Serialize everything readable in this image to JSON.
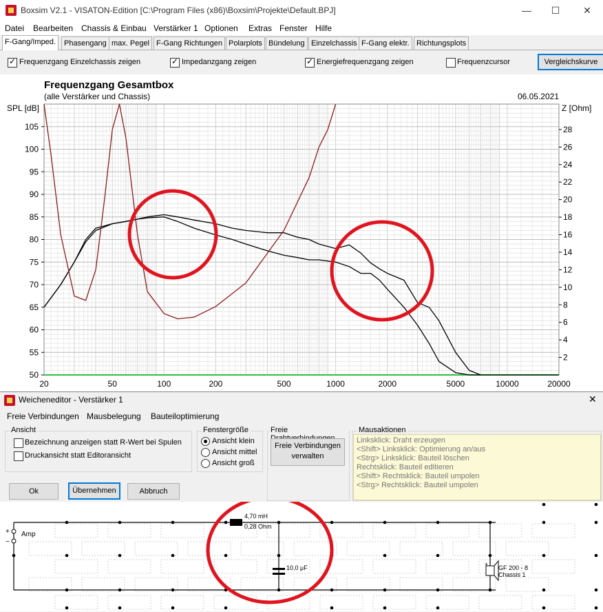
{
  "window": {
    "title": "Boxsim V2.1 - VISATON-Edition [C:\\Program Files (x86)\\Boxsim\\Projekte\\Default.BPJ]",
    "min_glyph": "—",
    "max_glyph": "☐",
    "close_glyph": "✕"
  },
  "menu": [
    "Datei",
    "Bearbeiten",
    "Chassis & Einbau",
    "Verstärker 1",
    "Optionen",
    "Extras",
    "Fenster",
    "Hilfe"
  ],
  "tabs": [
    "F-Gang/Imped.",
    "Phasengang",
    "max. Pegel",
    "F-Gang Richtungen",
    "Polarplots",
    "Bündelung",
    "Einzelchassis",
    "F-Gang elektr.",
    "Richtungsplots"
  ],
  "toolbar": {
    "chk1": "Frequenzgang Einzelchassis zeigen",
    "chk2": "Impedanzgang zeigen",
    "chk3": "Energiefrequenzgang zeigen",
    "chk4": "Frequenzcursor",
    "button": "Vergleichskurve"
  },
  "chart_data": {
    "type": "line",
    "title": "Frequenzgang Gesamtbox",
    "subtitle": "(alle Verstärker und Chassis)",
    "date": "06.05.2021",
    "ylabel": "SPL [dB]",
    "y2label": "Z [Ohm]",
    "x_scale": "log",
    "xlim": [
      20,
      20000
    ],
    "ylim": [
      50,
      110
    ],
    "y2lim": [
      0,
      30.9
    ],
    "x_ticks": [
      "20",
      "50",
      "100",
      "200",
      "500",
      "1000",
      "2000",
      "5000",
      "10000",
      "20000"
    ],
    "y_ticks": [
      "50",
      "55",
      "60",
      "65",
      "70",
      "75",
      "80",
      "85",
      "90",
      "95",
      "100",
      "105"
    ],
    "y2_ticks": [
      "2",
      "4",
      "6",
      "8",
      "10",
      "12",
      "14",
      "16",
      "18",
      "20",
      "22",
      "24",
      "26",
      "28"
    ],
    "grid": true,
    "series": [
      {
        "color": "#000000",
        "axis": "left",
        "x": [
          20,
          25,
          30,
          35,
          40,
          50,
          60,
          70,
          80,
          100,
          120,
          150,
          200,
          250,
          300,
          400,
          500,
          600,
          700,
          800,
          1000,
          1200,
          1400,
          1600,
          1800,
          2000,
          2500,
          3000,
          3500,
          4000,
          5000,
          6000,
          7000,
          10000,
          15000,
          20000
        ],
        "y": [
          65,
          70,
          75,
          80,
          82.5,
          83.5,
          84,
          84.5,
          85,
          85.5,
          85,
          84.3,
          83.5,
          82.5,
          82,
          81.5,
          81.5,
          80.5,
          80,
          79,
          78,
          78.8,
          77,
          74.8,
          73.5,
          72.5,
          71,
          66,
          65,
          62,
          55,
          51,
          50,
          50,
          50,
          50
        ]
      },
      {
        "color": "#000000",
        "axis": "left",
        "x": [
          20,
          25,
          30,
          35,
          40,
          50,
          60,
          70,
          80,
          100,
          120,
          150,
          200,
          250,
          300,
          400,
          500,
          600,
          700,
          800,
          1000,
          1200,
          1400,
          1600,
          1800,
          2000,
          2500,
          3000,
          3500,
          4000,
          5000,
          6000,
          7000
        ],
        "y": [
          65,
          70,
          75,
          79.5,
          82,
          83.5,
          84,
          84.5,
          84.8,
          85,
          84,
          82.5,
          81,
          80,
          79,
          77.5,
          76.5,
          76,
          75.5,
          75.5,
          75,
          74,
          72.5,
          72.5,
          71,
          69,
          65,
          61,
          57,
          53,
          50.5,
          50,
          50
        ]
      },
      {
        "color": "#8b1a1a",
        "axis": "right",
        "x": [
          20,
          22,
          25,
          30,
          35,
          40,
          45,
          50,
          55,
          60,
          70,
          80,
          100,
          120,
          150,
          200,
          300,
          500,
          700,
          800,
          900,
          1000
        ],
        "y": [
          30.9,
          25,
          16,
          9,
          8.5,
          12,
          20,
          28,
          30.9,
          27,
          16,
          9.5,
          7,
          6.4,
          6.6,
          7.8,
          10.5,
          16.5,
          22.5,
          26,
          28,
          30.9
        ]
      }
    ]
  },
  "dialog": {
    "title": "Weicheneditor - Verstärker 1",
    "close_glyph": "✕",
    "menu": [
      "Freie Verbindungen",
      "Mausbelegung",
      "Bauteiloptimierung"
    ],
    "ansicht_title": "Ansicht",
    "ansicht_opt1": "Bezeichnung anzeigen statt R-Wert bei Spulen",
    "ansicht_opt2": "Druckansicht statt Editoransicht",
    "fenster_title": "Fenstergröße",
    "radio1": "Ansicht klein",
    "radio2": "Ansicht mittel",
    "radio3": "Ansicht groß",
    "draht_title": "Freie Drahtverbindungen",
    "draht_button": "Freie Verbindungen verwalten",
    "maus_title": "Mausaktionen",
    "maus_lines": [
      "Linksklick: Draht erzeugen",
      "<Shift> Linksklick: Optimierung an/aus",
      "<Strg> Linksklick: Bauteil löschen",
      "Rechtsklick: Bauteil editieren",
      "<Shift> Rechtsklick: Bauteil umpolen",
      "<Strg> Rechtsklick: Bauteil umpolen"
    ],
    "ok": "Ok",
    "apply": "Übernehmen",
    "cancel": "Abbruch"
  },
  "circuit": {
    "amp_label": "Amp",
    "plus": "+",
    "minus": "−",
    "inductor_value": "4,70 mH",
    "inductor_r": "0,28 Ohm",
    "cap_value": "10,0 µF",
    "chassis_name": "GF 200 - 8",
    "chassis_id": "Chassis 1",
    "speaker_plus": "+"
  }
}
